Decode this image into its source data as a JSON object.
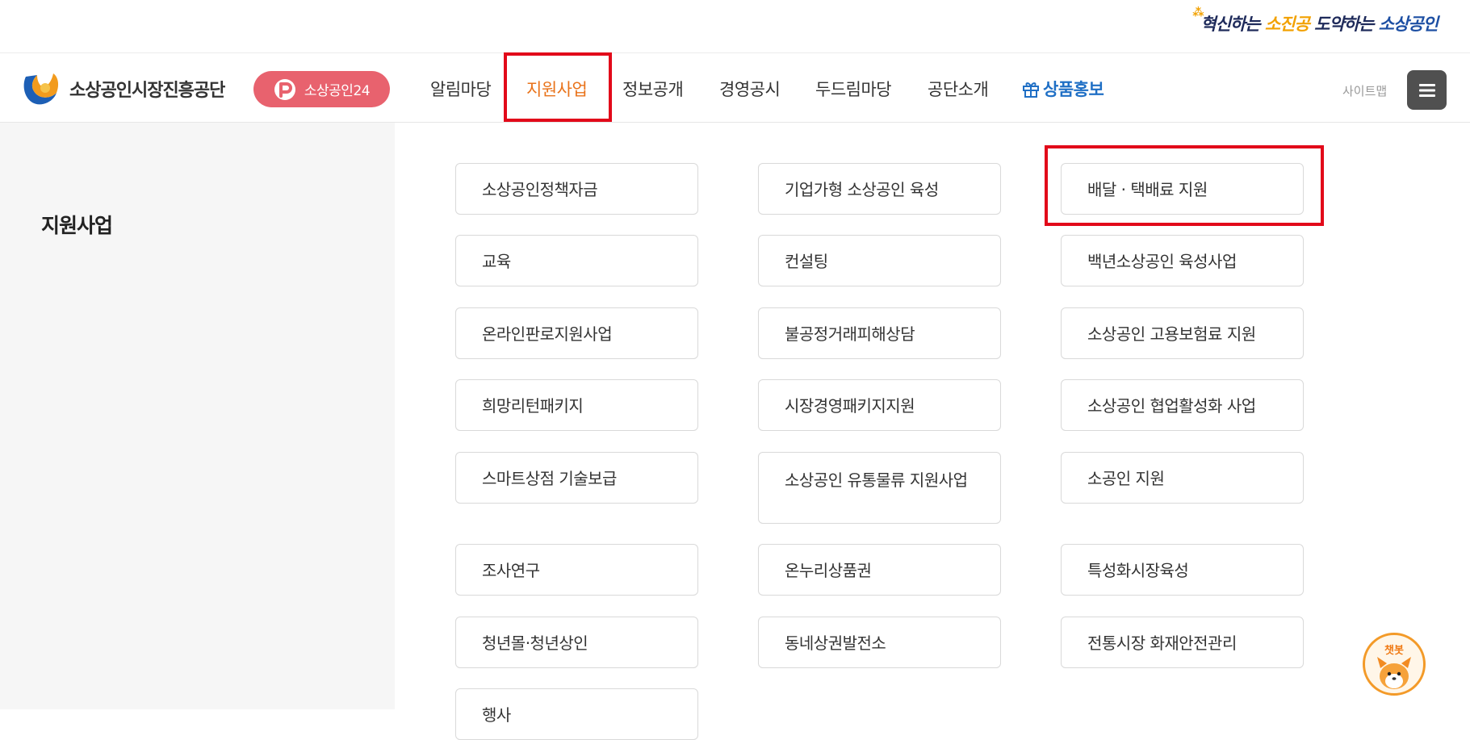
{
  "slogan": {
    "part1": "혁신하는 ",
    "part2": "소진공",
    "part3": " 도약하는 ",
    "part4": "소상공인"
  },
  "header": {
    "logo_text": "소상공인시장진흥공단",
    "pill_label": "소상공인24",
    "nav": [
      "알림마당",
      "지원사업",
      "정보공개",
      "경영공시",
      "두드림마당",
      "공단소개",
      "상품홍보"
    ],
    "active_nav": "지원사업",
    "sitemap_label": "사이트맵",
    "menu_icon": "hamburger-icon",
    "colors": {
      "active": "#e9731b",
      "promo": "#1f6fc5",
      "pill": "#e8626e"
    }
  },
  "section": {
    "title": "지원사업"
  },
  "menu": {
    "col1": [
      "소상공인정책자금",
      "교육",
      "온라인판로지원사업",
      "희망리턴패키지",
      "스마트상점 기술보급",
      "조사연구",
      "청년몰·청년상인",
      "행사"
    ],
    "col2": [
      "기업가형 소상공인 육성",
      "컨설팅",
      "불공정거래피해상담",
      "시장경영패키지지원",
      "소상공인 유통물류 지원사업",
      "온누리상품권",
      "동네상권발전소"
    ],
    "col3": [
      "배달 · 택배료 지원",
      "백년소상공인 육성사업",
      "소상공인 고용보험료 지원",
      "소상공인 협업활성화 사업",
      "소공인 지원",
      "특성화시장육성",
      "전통시장 화재안전관리"
    ]
  },
  "chatbot": {
    "label": "챗봇"
  },
  "highlight_color": "#e2091a"
}
